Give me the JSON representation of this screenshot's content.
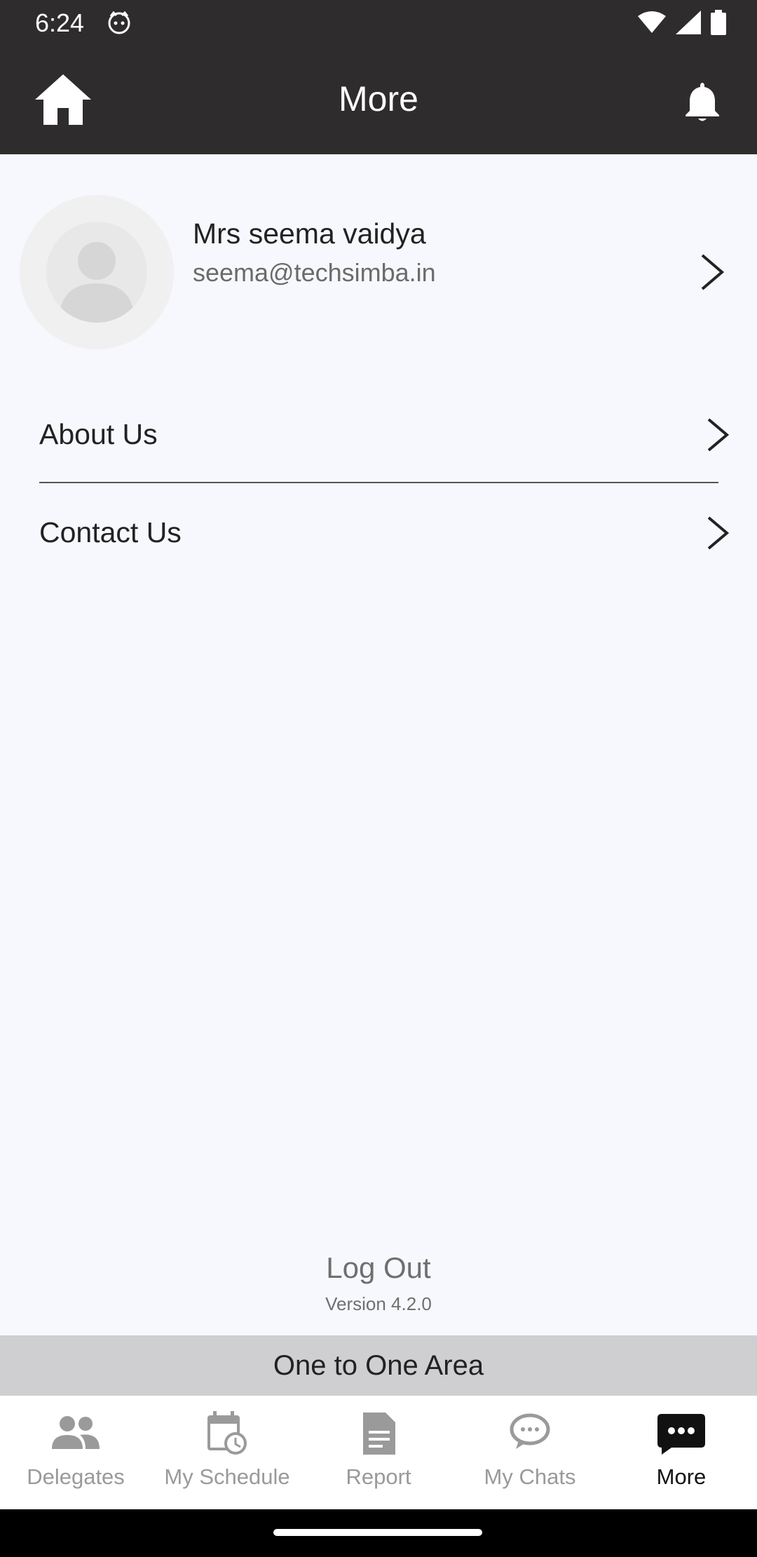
{
  "status_bar": {
    "time": "6:24"
  },
  "app_bar": {
    "title": "More"
  },
  "profile": {
    "name": "Mrs seema vaidya",
    "email": "seema@techsimba.in"
  },
  "menu": [
    {
      "label": "About Us"
    },
    {
      "label": "Contact Us"
    }
  ],
  "footer": {
    "logout_label": "Log Out",
    "version": "Version 4.2.0",
    "one_to_one": "One to One Area"
  },
  "bottom_nav": [
    {
      "label": "Delegates",
      "icon": "people-icon",
      "active": false
    },
    {
      "label": "My Schedule",
      "icon": "calendar-clock-icon",
      "active": false
    },
    {
      "label": "Report",
      "icon": "document-icon",
      "active": false
    },
    {
      "label": "My Chats",
      "icon": "chat-bubble-icon",
      "active": false
    },
    {
      "label": "More",
      "icon": "more-chat-icon",
      "active": true
    }
  ],
  "colors": {
    "app_bar": "#2f2c2d",
    "background": "#f7f8fd",
    "active_nav": "#111111",
    "inactive_nav": "#9a9a9a"
  }
}
